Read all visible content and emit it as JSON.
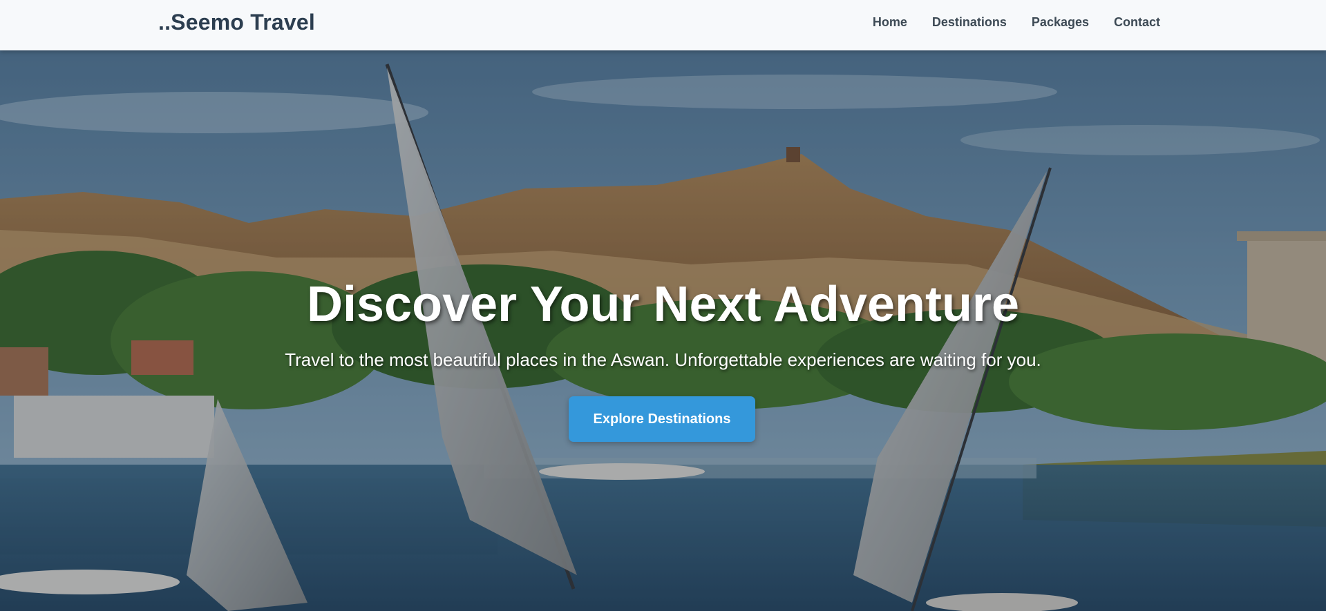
{
  "header": {
    "brand": "..Seemo Travel",
    "nav": [
      {
        "label": "Home"
      },
      {
        "label": "Destinations"
      },
      {
        "label": "Packages"
      },
      {
        "label": "Contact"
      }
    ]
  },
  "hero": {
    "title": "Discover Your Next Adventure",
    "subtitle": "Travel to the most beautiful places in the Aswan. Unforgettable experiences are waiting for you.",
    "cta_label": "Explore Destinations",
    "background_image": "aswan-nile-feluccas-photo"
  },
  "colors": {
    "header_bg": "#f7f9fb",
    "brand_text": "#2c3e50",
    "nav_text": "#3d4a55",
    "cta_bg": "#3498db",
    "hero_text": "#ffffff"
  }
}
